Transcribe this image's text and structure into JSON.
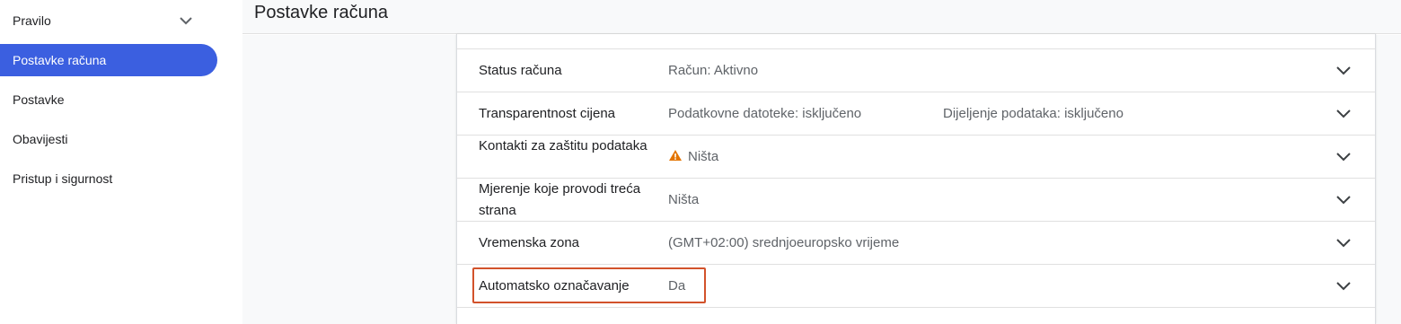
{
  "sidebar": {
    "items": [
      {
        "label": "Pravilo"
      },
      {
        "label": "Postavke računa"
      },
      {
        "label": "Postavke"
      },
      {
        "label": "Obavijesti"
      },
      {
        "label": "Pristup i sigurnost"
      }
    ],
    "active_index": 1
  },
  "header": {
    "title": "Postavke računa"
  },
  "settings": {
    "rows": [
      {
        "label": "Status računa",
        "value": "Račun: Aktivno"
      },
      {
        "label": "Transparentnost cijena",
        "value": "Podatkovne datoteke: isključeno",
        "value2": "Dijeljenje podataka: isključeno"
      },
      {
        "label": "Kontakti za zaštitu podataka",
        "value": "Ništa",
        "icon": "warning-icon"
      },
      {
        "label": "Mjerenje koje provodi treća strana",
        "value": "Ništa"
      },
      {
        "label": "Vremenska zona",
        "value": "(GMT+02:00) srednjoeuropsko vrijeme"
      },
      {
        "label": "Automatsko označavanje",
        "value": "Da",
        "highlighted": true
      }
    ]
  },
  "colors": {
    "accent": "#3b5fe0",
    "highlight_border": "#d2522b",
    "warning": "#e37400"
  }
}
